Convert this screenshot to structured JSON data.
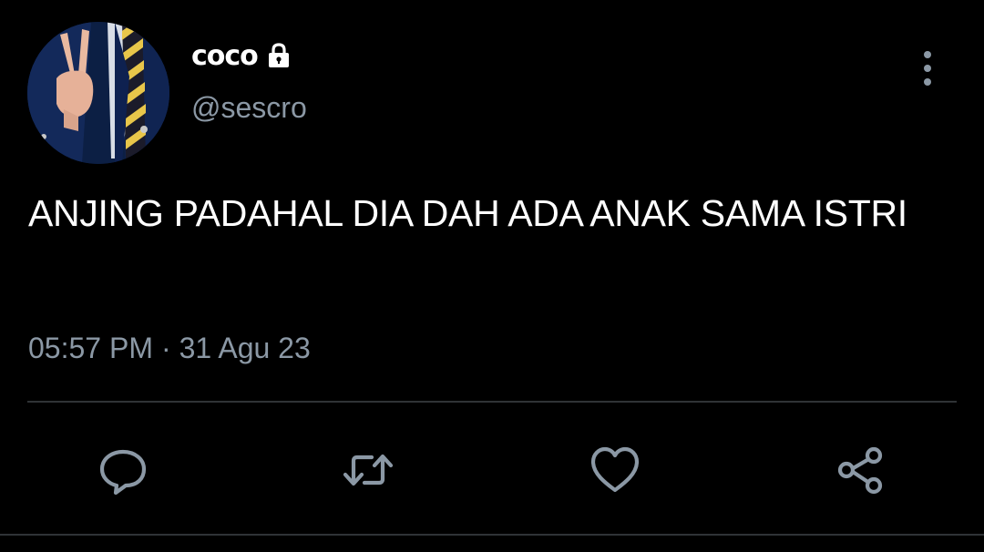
{
  "user": {
    "display_name": "coco",
    "handle": "@sescro",
    "protected_icon": "lock-icon",
    "avatar_icon": "avatar-peace-sign-photo"
  },
  "tweet": {
    "text": "ANJING PADAHAL DIA DAH ADA ANAK SAMA ISTRI",
    "time": "05:57 PM",
    "separator": "·",
    "date": "31 Agu 23"
  },
  "menu": {
    "more_icon": "more-vertical-icon"
  },
  "actions": [
    {
      "name": "reply",
      "icon": "reply-icon"
    },
    {
      "name": "retweet",
      "icon": "retweet-icon"
    },
    {
      "name": "like",
      "icon": "heart-icon"
    },
    {
      "name": "share",
      "icon": "share-icon"
    }
  ],
  "colors": {
    "background": "#000000",
    "primary_text": "#ffffff",
    "secondary_text": "#8b98a5",
    "divider": "#2f3336"
  }
}
